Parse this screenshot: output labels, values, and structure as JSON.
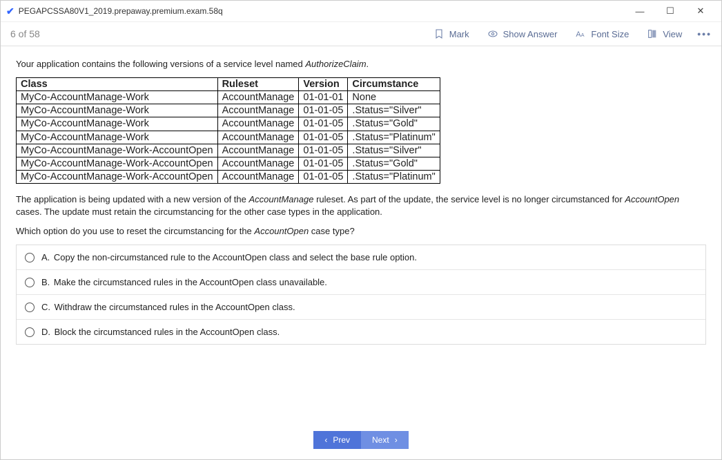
{
  "title": "PEGAPCSSA80V1_2019.prepaway.premium.exam.58q",
  "counter": "6 of 58",
  "toolbar": {
    "mark": "Mark",
    "show_answer": "Show Answer",
    "font_size": "Font Size",
    "view": "View"
  },
  "question": {
    "intro_prefix": "Your application contains the following versions of a service level named ",
    "intro_em": "AuthorizeClaim",
    "intro_suffix": ".",
    "table": {
      "headers": {
        "class": "Class",
        "ruleset": "Ruleset",
        "version": "Version",
        "circumstance": "Circumstance"
      },
      "rows": [
        {
          "class": "MyCo-AccountManage-Work",
          "ruleset": "AccountManage",
          "version": "01-01-01",
          "circumstance": "None"
        },
        {
          "class": "MyCo-AccountManage-Work",
          "ruleset": "AccountManage",
          "version": "01-01-05",
          "circumstance": ".Status=\"Silver\""
        },
        {
          "class": "MyCo-AccountManage-Work",
          "ruleset": "AccountManage",
          "version": "01-01-05",
          "circumstance": ".Status=\"Gold\""
        },
        {
          "class": "MyCo-AccountManage-Work",
          "ruleset": "AccountManage",
          "version": "01-01-05",
          "circumstance": ".Status=\"Platinum\""
        },
        {
          "class": "MyCo-AccountManage-Work-AccountOpen",
          "ruleset": "AccountManage",
          "version": "01-01-05",
          "circumstance": ".Status=\"Silver\""
        },
        {
          "class": "MyCo-AccountManage-Work-AccountOpen",
          "ruleset": "AccountManage",
          "version": "01-01-05",
          "circumstance": ".Status=\"Gold\""
        },
        {
          "class": "MyCo-AccountManage-Work-AccountOpen",
          "ruleset": "AccountManage",
          "version": "01-01-05",
          "circumstance": ".Status=\"Platinum\""
        }
      ]
    },
    "para1_a": "The application is being updated with a new version of the ",
    "para1_em1": "AccountManage",
    "para1_b": " ruleset. As part of the update, the service level is no longer circumstanced for ",
    "para1_em2": "AccountOpen",
    "para1_c": " cases. The update must retain the circumstancing for the other case types in the application.",
    "question_line_a": "Which option do you use to reset the circumstancing for the ",
    "question_line_em": "AccountOpen",
    "question_line_b": " case type?",
    "options": [
      {
        "letter": "A.",
        "text": "Copy the non-circumstanced rule to the AccountOpen class and select the base rule option."
      },
      {
        "letter": "B.",
        "text": "Make the circumstanced rules in the AccountOpen class unavailable."
      },
      {
        "letter": "C.",
        "text": "Withdraw the circumstanced rules in the AccountOpen class."
      },
      {
        "letter": "D.",
        "text": "Block the circumstanced rules in the AccountOpen class."
      }
    ]
  },
  "nav": {
    "prev": "Prev",
    "next": "Next"
  }
}
